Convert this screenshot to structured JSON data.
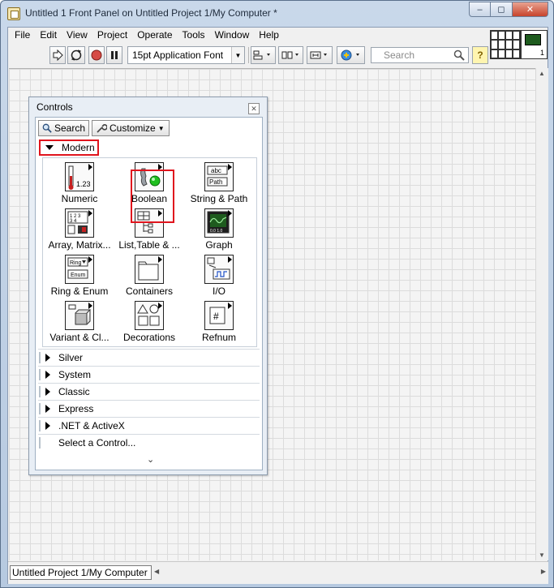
{
  "window": {
    "title": "Untitled 1 Front Panel on Untitled Project 1/My Computer *",
    "minimize": "–",
    "maximize": "◻",
    "close": "✕"
  },
  "menubar": [
    "File",
    "Edit",
    "View",
    "Project",
    "Operate",
    "Tools",
    "Window",
    "Help"
  ],
  "toolbar": {
    "font": "15pt Application Font",
    "search_placeholder": "Search",
    "help": "?"
  },
  "vi_icon": {
    "number": "1"
  },
  "status_bar": {
    "path": "Untitled Project 1/My Computer"
  },
  "palette": {
    "title": "Controls",
    "search_button": "Search",
    "customize_button": "Customize",
    "open_category": "Modern",
    "items": [
      {
        "label": "Numeric"
      },
      {
        "label": "Boolean"
      },
      {
        "label": "String & Path"
      },
      {
        "label": "Array, Matrix..."
      },
      {
        "label": "List,Table & ..."
      },
      {
        "label": "Graph"
      },
      {
        "label": "Ring & Enum"
      },
      {
        "label": "Containers"
      },
      {
        "label": "I/O"
      },
      {
        "label": "Variant & Cl..."
      },
      {
        "label": "Decorations"
      },
      {
        "label": "Refnum"
      }
    ],
    "categories": [
      "Silver",
      "System",
      "Classic",
      "Express",
      ".NET & ActiveX"
    ],
    "select_control": "Select a Control...",
    "more": "⌄"
  },
  "colors": {
    "highlight": "#e0141d",
    "boolean_led": "#1fbf1f",
    "graph_screen": "#1e5b1e"
  }
}
